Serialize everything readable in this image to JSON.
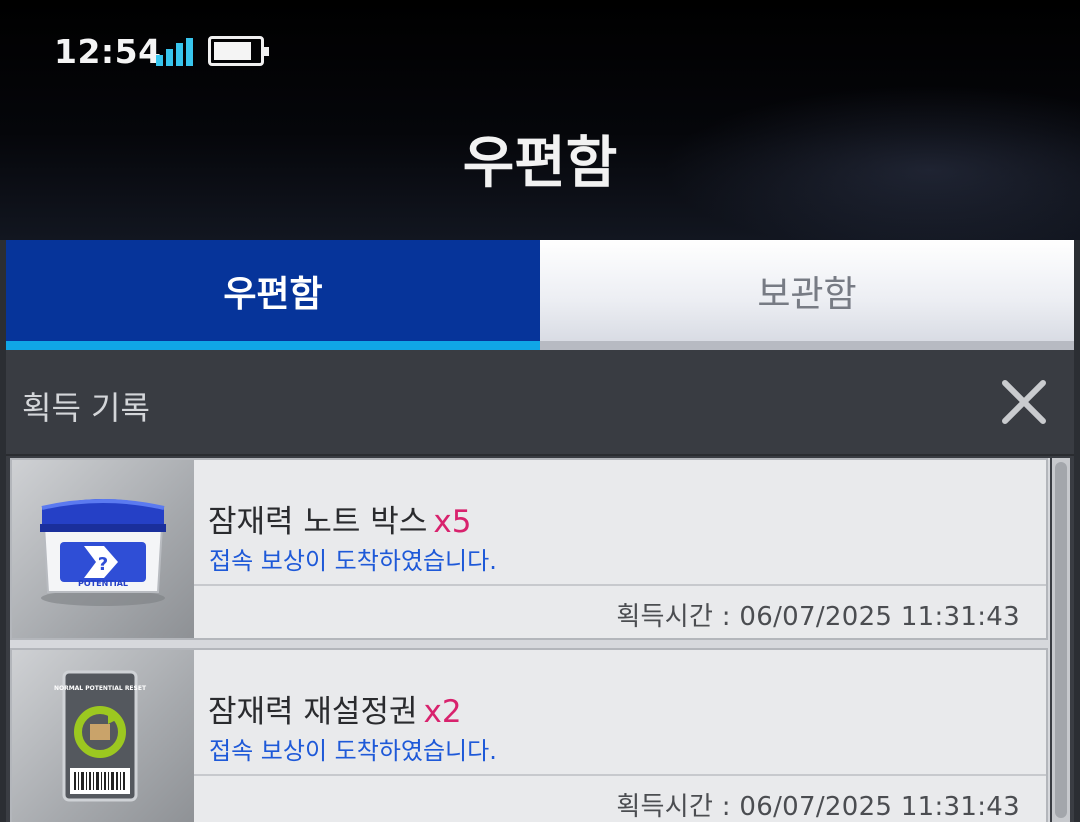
{
  "status_bar": {
    "time": "12:54",
    "signal_icon": "signal-bars-icon",
    "battery_icon": "battery-icon",
    "battery_level": 0.85
  },
  "header": {
    "title": "우편함"
  },
  "tabs": [
    {
      "label": "우편함",
      "active": true
    },
    {
      "label": "보관함",
      "active": false
    }
  ],
  "panel": {
    "title": "획득 기록",
    "close_icon": "close-icon"
  },
  "items": [
    {
      "name": "잠재력 노트 박스",
      "qty": "x5",
      "desc": "접속 보상이 도착하였습니다.",
      "acquired": "획득시간 : 06/07/2025 11:31:43",
      "icon": "potential-box-icon",
      "icon_text": "POTENTIAL"
    },
    {
      "name": "잠재력 재설정권",
      "qty": "x2",
      "desc": "접속 보상이 도착하였습니다.",
      "acquired": "획득시간 : 06/07/2025 11:31:43",
      "icon": "potential-reset-ticket-icon",
      "icon_text": "NORMAL POTENTIAL RESET"
    }
  ],
  "colors": {
    "active_tab": "#06349a",
    "tab_indicator": "#10a6e6",
    "quantity": "#d8226d",
    "description": "#1e59d8"
  }
}
